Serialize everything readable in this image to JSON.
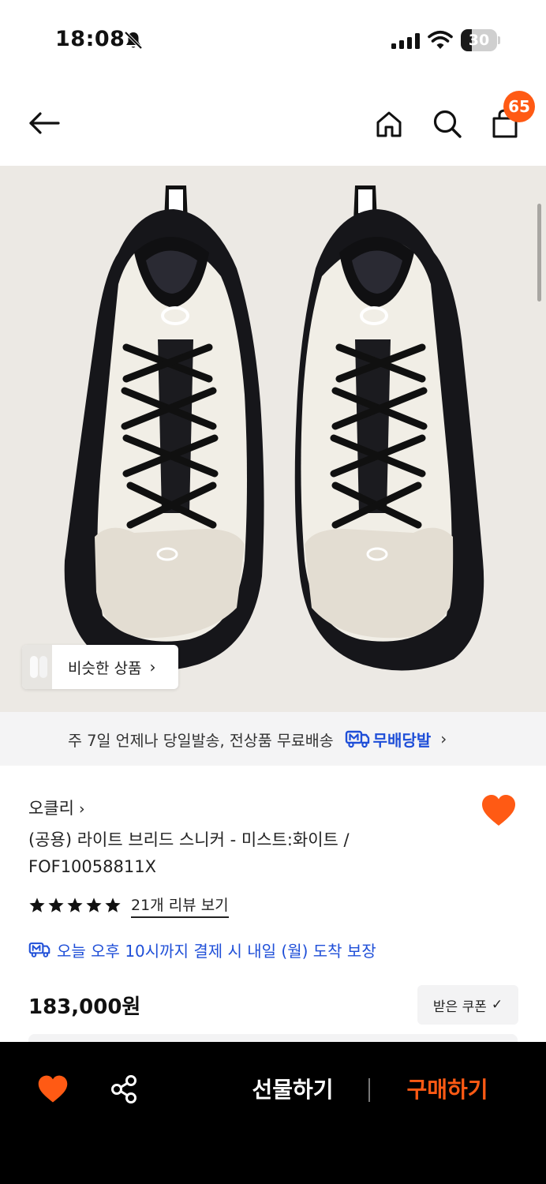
{
  "status_bar": {
    "time": "18:08",
    "battery": "30",
    "battery_level": 0.3
  },
  "header": {
    "back_icon": "arrow-left-icon",
    "home_icon": "home-icon",
    "search_icon": "search-icon",
    "cart_icon": "shopping-bag-icon",
    "cart_count": "65"
  },
  "product_image": {
    "similar_products_label": "비슷한 상품",
    "similar_products_chevron": "›"
  },
  "delivery_banner": {
    "text": "주 7일 언제나 당일발송, 전상품 무료배송",
    "brand": "무배당발",
    "chevron": "›"
  },
  "product": {
    "brand": "오클리",
    "brand_chevron": "›",
    "title": "(공용) 라이트 브리드 스니커 - 미스트:화이트 / FOF10058811X",
    "rating_stars": 5,
    "review_link": "21개 리뷰 보기",
    "arrival_guarantee": "오늘 오후 10시까지 결제 시 내일 (월) 도착 보장",
    "price": "183,000원",
    "coupon_label": "받은 쿠폰",
    "coupon_check": "✓"
  },
  "bottom_bar": {
    "gift_label": "선물하기",
    "buy_label": "구매하기"
  },
  "colors": {
    "accent": "#ff5a14",
    "link_blue": "#1f4fd8"
  }
}
